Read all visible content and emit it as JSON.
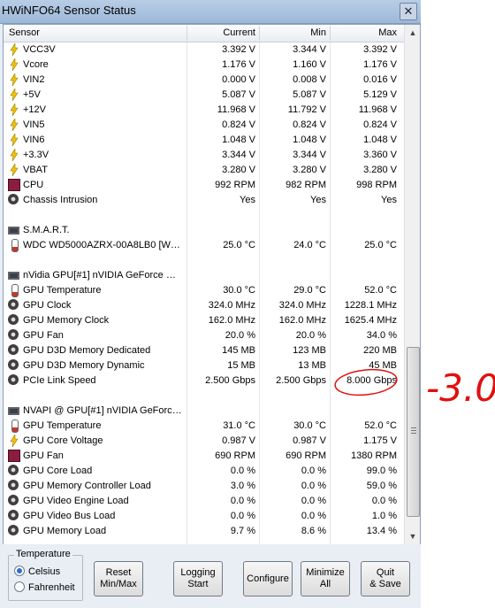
{
  "window": {
    "title": "HWiNFO64 Sensor Status"
  },
  "columns": {
    "sensor": "Sensor",
    "current": "Current",
    "min": "Min",
    "max": "Max"
  },
  "rows": [
    {
      "type": "volt",
      "name": "VCC3V",
      "current": "3.392 V",
      "min": "3.344 V",
      "max": "3.392 V"
    },
    {
      "type": "volt",
      "name": "Vcore",
      "current": "1.176 V",
      "min": "1.160 V",
      "max": "1.176 V"
    },
    {
      "type": "volt",
      "name": "VIN2",
      "current": "0.000 V",
      "min": "0.008 V",
      "max": "0.016 V"
    },
    {
      "type": "volt",
      "name": "+5V",
      "current": "5.087 V",
      "min": "5.087 V",
      "max": "5.129 V"
    },
    {
      "type": "volt",
      "name": "+12V",
      "current": "11.968 V",
      "min": "11.792 V",
      "max": "11.968 V"
    },
    {
      "type": "volt",
      "name": "VIN5",
      "current": "0.824 V",
      "min": "0.824 V",
      "max": "0.824 V"
    },
    {
      "type": "volt",
      "name": "VIN6",
      "current": "1.048 V",
      "min": "1.048 V",
      "max": "1.048 V"
    },
    {
      "type": "volt",
      "name": "+3.3V",
      "current": "3.344 V",
      "min": "3.344 V",
      "max": "3.360 V"
    },
    {
      "type": "volt",
      "name": "VBAT",
      "current": "3.280 V",
      "min": "3.280 V",
      "max": "3.280 V"
    },
    {
      "type": "fan",
      "name": "CPU",
      "current": "992 RPM",
      "min": "982 RPM",
      "max": "998 RPM"
    },
    {
      "type": "gear",
      "name": "Chassis Intrusion",
      "current": "Yes",
      "min": "Yes",
      "max": "Yes"
    },
    {
      "type": "blank"
    },
    {
      "type": "group",
      "name": "S.M.A.R.T."
    },
    {
      "type": "temp",
      "name": "WDC WD5000AZRX-00A8LB0 [WD-...",
      "current": "25.0 °C",
      "min": "24.0 °C",
      "max": "25.0 °C"
    },
    {
      "type": "blank"
    },
    {
      "type": "group",
      "name": "nVidia GPU[#1] nVIDIA GeForce GT..."
    },
    {
      "type": "temp",
      "name": "GPU Temperature",
      "current": "30.0 °C",
      "min": "29.0 °C",
      "max": "52.0 °C"
    },
    {
      "type": "gear",
      "name": "GPU Clock",
      "current": "324.0 MHz",
      "min": "324.0 MHz",
      "max": "1228.1 MHz"
    },
    {
      "type": "gear",
      "name": "GPU Memory Clock",
      "current": "162.0 MHz",
      "min": "162.0 MHz",
      "max": "1625.4 MHz"
    },
    {
      "type": "gear",
      "name": "GPU Fan",
      "current": "20.0 %",
      "min": "20.0 %",
      "max": "34.0 %"
    },
    {
      "type": "gear",
      "name": "GPU D3D Memory Dedicated",
      "current": "145 MB",
      "min": "123 MB",
      "max": "220 MB"
    },
    {
      "type": "gear",
      "name": "GPU D3D Memory Dynamic",
      "current": "15 MB",
      "min": "13 MB",
      "max": "45 MB"
    },
    {
      "type": "gear",
      "name": "PCIe Link Speed",
      "current": "2.500 Gbps",
      "min": "2.500 Gbps",
      "max": "8.000 Gbps"
    },
    {
      "type": "blank"
    },
    {
      "type": "group",
      "name": "NVAPI @ GPU[#1] nVIDIA GeForce ..."
    },
    {
      "type": "temp",
      "name": "GPU Temperature",
      "current": "31.0 °C",
      "min": "30.0 °C",
      "max": "52.0 °C"
    },
    {
      "type": "volt",
      "name": "GPU Core Voltage",
      "current": "0.987 V",
      "min": "0.987 V",
      "max": "1.175 V"
    },
    {
      "type": "fan",
      "name": "GPU Fan",
      "current": "690 RPM",
      "min": "690 RPM",
      "max": "1380 RPM"
    },
    {
      "type": "gear",
      "name": "GPU Core Load",
      "current": "0.0 %",
      "min": "0.0 %",
      "max": "99.0 %"
    },
    {
      "type": "gear",
      "name": "GPU Memory Controller Load",
      "current": "3.0 %",
      "min": "0.0 %",
      "max": "59.0 %"
    },
    {
      "type": "gear",
      "name": "GPU Video Engine Load",
      "current": "0.0 %",
      "min": "0.0 %",
      "max": "0.0 %"
    },
    {
      "type": "gear",
      "name": "GPU Video Bus Load",
      "current": "0.0 %",
      "min": "0.0 %",
      "max": "1.0 %"
    },
    {
      "type": "gear",
      "name": "GPU Memory Load",
      "current": "9.7 %",
      "min": "8.6 %",
      "max": "13.4 %"
    }
  ],
  "temperature": {
    "legend": "Temperature",
    "celsius": "Celsius",
    "fahrenheit": "Fahrenheit",
    "selected": "Celsius"
  },
  "buttons": {
    "reset": "Reset\nMin/Max",
    "logging": "Logging\nStart",
    "configure": "Configure",
    "minimize": "Minimize\nAll",
    "quit": "Quit\n& Save"
  },
  "annotation": {
    "text": "-3.0",
    "color": "#e01010"
  }
}
